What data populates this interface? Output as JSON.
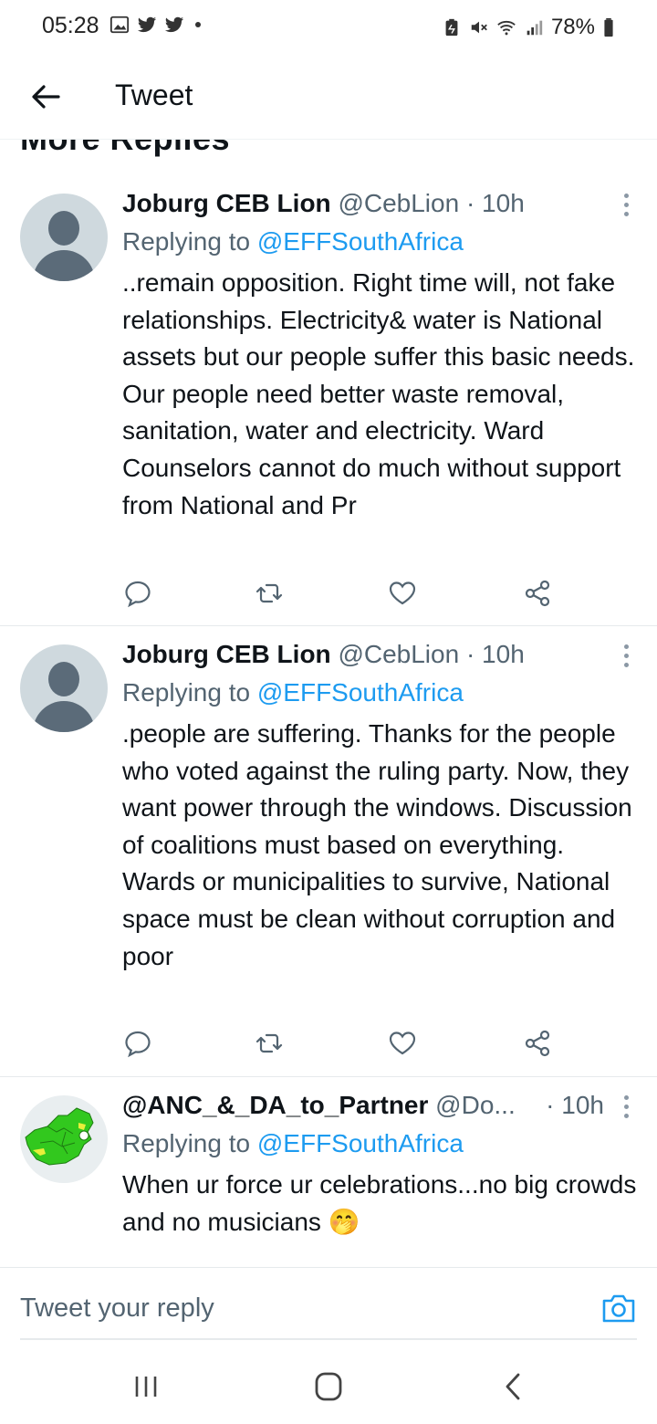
{
  "status_bar": {
    "time": "05:28",
    "battery": "78%",
    "left_icons": [
      "gallery-icon",
      "twitter-icon",
      "twitter-icon",
      "dot"
    ],
    "right_icons": [
      "battery-saver-icon",
      "mute-icon",
      "wifi-icon",
      "signal-icon",
      "battery-icon"
    ]
  },
  "header": {
    "title": "Tweet"
  },
  "section": {
    "heading": "More Replies"
  },
  "tweets": [
    {
      "name": "Joburg CEB Lion",
      "handle": "@CebLion · 10h",
      "replying_prefix": "Replying to ",
      "replying_to": "@EFFSouthAfrica",
      "text": "..remain opposition. Right time will, not fake relationships. Electricity& water is National assets but our people suffer this basic needs. Our people need better waste removal, sanitation, water and electricity. Ward Counselors cannot do much without support from National and Pr"
    },
    {
      "name": "Joburg CEB Lion",
      "handle": "@CebLion · 10h",
      "replying_prefix": "Replying to ",
      "replying_to": "@EFFSouthAfrica",
      "text": ".people are suffering. Thanks for the people who voted against the ruling party. Now, they want power through the windows. Discussion of coalitions must based on everything. Wards or municipalities to survive, National space must be clean without corruption and poor"
    },
    {
      "name": "@ANC_&_DA_to_Partner",
      "handle": "@Do...",
      "time": "· 10h",
      "replying_prefix": "Replying to ",
      "replying_to": "@EFFSouthAfrica",
      "text": "When ur force ur celebrations...no big crowds and no musicians 🤭"
    }
  ],
  "reply_bar": {
    "placeholder": "Tweet your reply"
  },
  "colors": {
    "link": "#1d9bf0",
    "secondary": "#536471",
    "primary": "#0f1419"
  }
}
